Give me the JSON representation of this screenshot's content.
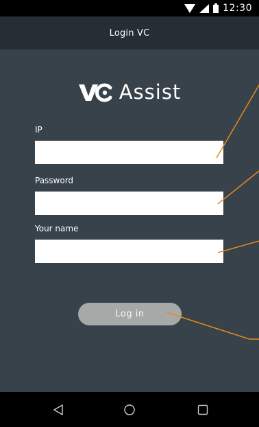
{
  "status_bar": {
    "time": "12:30",
    "icons": [
      "wifi-icon",
      "signal-icon",
      "battery-icon"
    ]
  },
  "app_bar": {
    "title": "Login VC"
  },
  "logo": {
    "mark_text": "VC",
    "text": "Assist"
  },
  "form": {
    "ip": {
      "label": "IP",
      "value": "",
      "placeholder": ""
    },
    "password": {
      "label": "Password",
      "value": "",
      "placeholder": ""
    },
    "name": {
      "label": "Your name",
      "value": "",
      "placeholder": ""
    },
    "login_label": "Log in"
  },
  "nav_bar": {
    "icons": [
      "back-icon",
      "home-icon",
      "recents-icon"
    ]
  },
  "colors": {
    "background": "#37424b",
    "app_bar": "#252e34",
    "status_bar": "#000000",
    "nav_bar": "#000000",
    "accent": "#e88a1a",
    "input_background": "#ffffff",
    "button_background": "#a7a8a8",
    "button_text": "#f7f7f7"
  }
}
